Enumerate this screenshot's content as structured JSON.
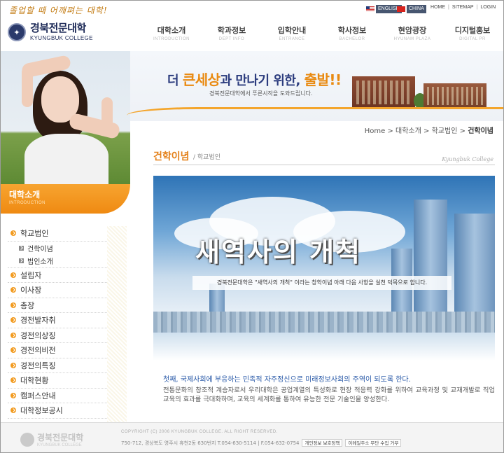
{
  "header": {
    "slogan": "졸업할 때 어깨펴는 대학!",
    "logo_ko": "경북전문대학",
    "logo_en": "KYUNGBUK COLLEGE",
    "lang_english": "ENGLISH",
    "lang_china": "CHINA",
    "util": [
      "HOME",
      "SITEMAP",
      "LOGIN"
    ]
  },
  "gnb": [
    {
      "ko": "대학소개",
      "en": "INTRODUCTION"
    },
    {
      "ko": "학과정보",
      "en": "DEPT INFO"
    },
    {
      "ko": "입학안내",
      "en": "ENTRANCE"
    },
    {
      "ko": "학사정보",
      "en": "BACHELOR"
    },
    {
      "ko": "현암광장",
      "en": "HYUNAM PLAZA"
    },
    {
      "ko": "디지털홍보",
      "en": "DIGITAL PR"
    }
  ],
  "banner": {
    "pre": "더",
    "highlight": "큰세상",
    "mid": "과 만나기 위한,",
    "go": "출발!!",
    "sub": "경북전문대학에서 푸른시작을 도와드립니다."
  },
  "section": {
    "ko": "대학소개",
    "en": "INTRODUCTION"
  },
  "lnb": {
    "group": "학교법인",
    "subs": [
      "건학이념",
      "법인소개"
    ],
    "items": [
      "설립자",
      "이사장",
      "총장",
      "경전발자취",
      "경전의상징",
      "경전의비전",
      "경전의특징",
      "대학현황",
      "캠퍼스안내",
      "대학정보공시"
    ]
  },
  "breadcrumb": {
    "home": "Home",
    "l1": "대학소개",
    "l2": "학교법인",
    "current": "건학이념",
    "sep": ">"
  },
  "page": {
    "title": "건학이념",
    "sub": "/ 학교법인",
    "brand": "Kyungbuk College"
  },
  "hero": {
    "title": "새역사의 개척",
    "sub": "경북전문대학은 \"새역사의 개척\" 이라는 창학이념 아래 다음 사항을 실천 덕목으로 합니다."
  },
  "intro": {
    "line1": "첫째, 국제사회에 부응하는 민족적 자주정신으로 미래정보사회의 주역이 되도록 한다.",
    "line2": "전통문화의 창조적 계승자로서 우리대학은 공업계열의 특성화로 현장 적응력 강화를 위하여 교육과정 및 교재개발로 직업교육의 효과를 극대화하며, 교육의 세계화를 통하여 유능한 전문 기술인을 양성한다."
  },
  "footer": {
    "logo_ko": "경북전문대학",
    "logo_en": "KYUNGBUK COLLEGE",
    "copyright": "COPYRIGHT (C) 2006 KYUNGBUK COLLEGE. ALL RIGHT RESERVED.",
    "address": "750-712, 경상북도 영주시 휴천2동 630번지 T.054-630-5114 | F.054-632-0754",
    "link1": "개인정보 보호정책",
    "link2": "이메일주소 무단 수집 거부"
  }
}
